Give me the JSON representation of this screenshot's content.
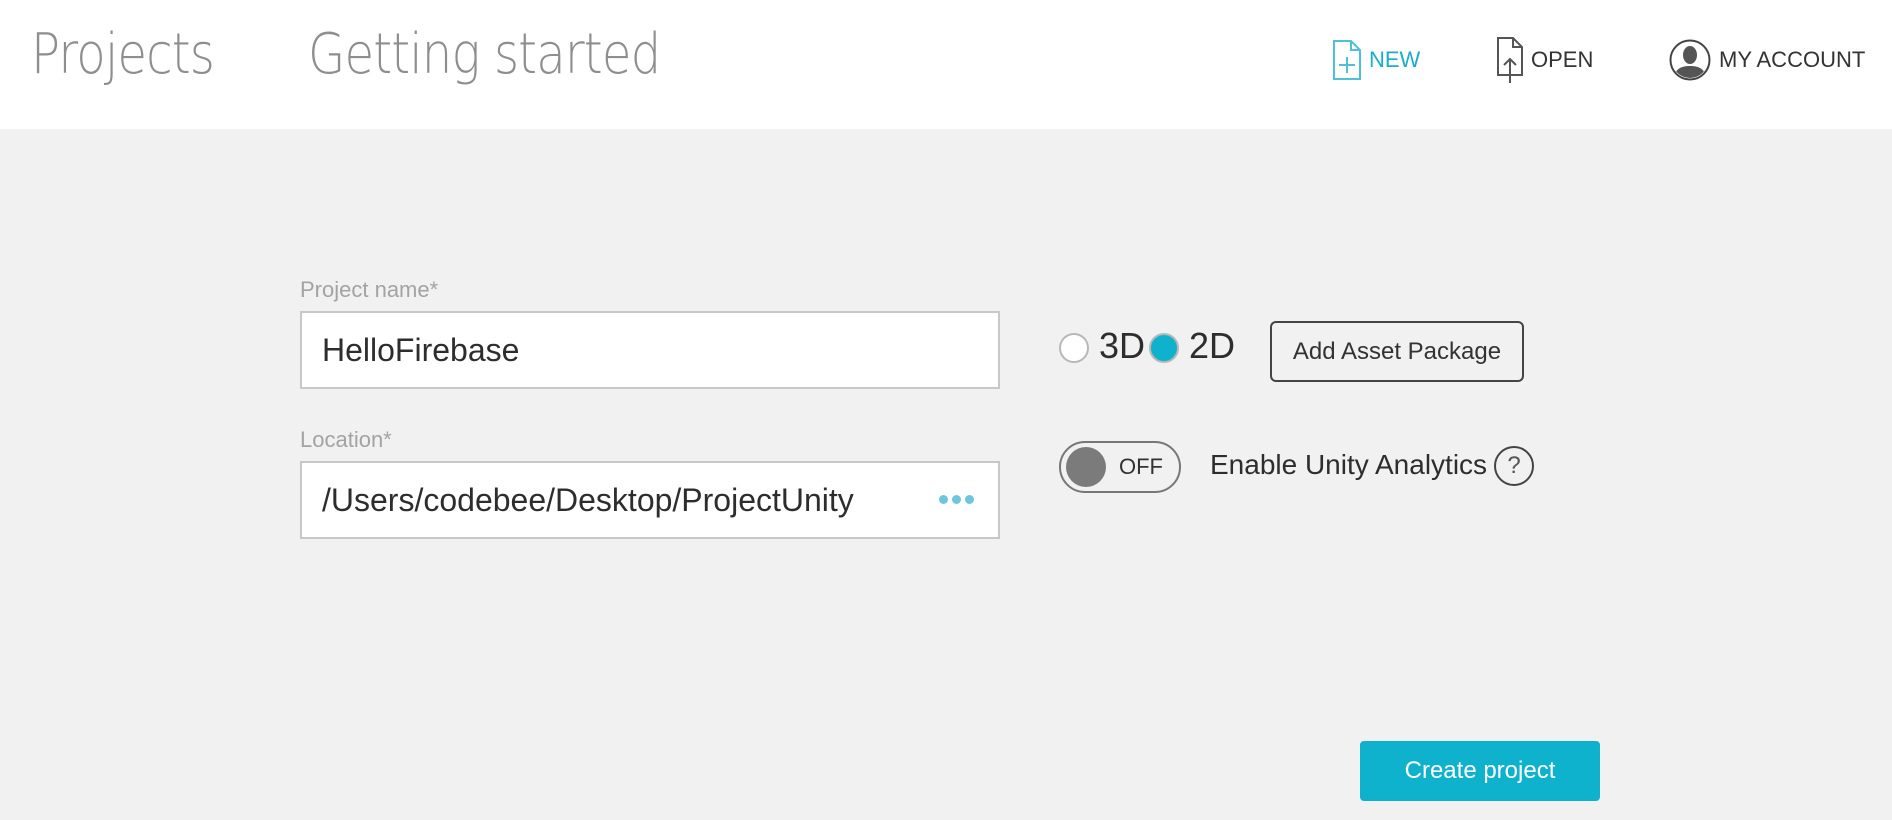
{
  "header": {
    "tabs": [
      {
        "label": "Projects"
      },
      {
        "label": "Getting started"
      }
    ],
    "actions": {
      "new": {
        "label": "NEW",
        "icon": "new-file-icon",
        "color": "#1aaecb"
      },
      "open": {
        "label": "OPEN",
        "icon": "open-file-icon"
      },
      "account": {
        "label": "MY ACCOUNT",
        "icon": "account-icon"
      }
    }
  },
  "form": {
    "project_name": {
      "label": "Project name*",
      "value": "HelloFirebase"
    },
    "location": {
      "label": "Location*",
      "value": "/Users/codebee/Desktop/ProjectUnity",
      "browse_icon": "ellipsis-icon"
    },
    "mode": {
      "options": [
        {
          "label": "3D",
          "selected": false
        },
        {
          "label": "2D",
          "selected": true
        }
      ]
    },
    "add_asset_package_label": "Add Asset Package",
    "analytics": {
      "toggle_state": "OFF",
      "label": "Enable Unity Analytics",
      "help": "?"
    },
    "create_label": "Create project"
  },
  "colors": {
    "accent": "#0fb2cc",
    "background": "#f1f1f1"
  }
}
